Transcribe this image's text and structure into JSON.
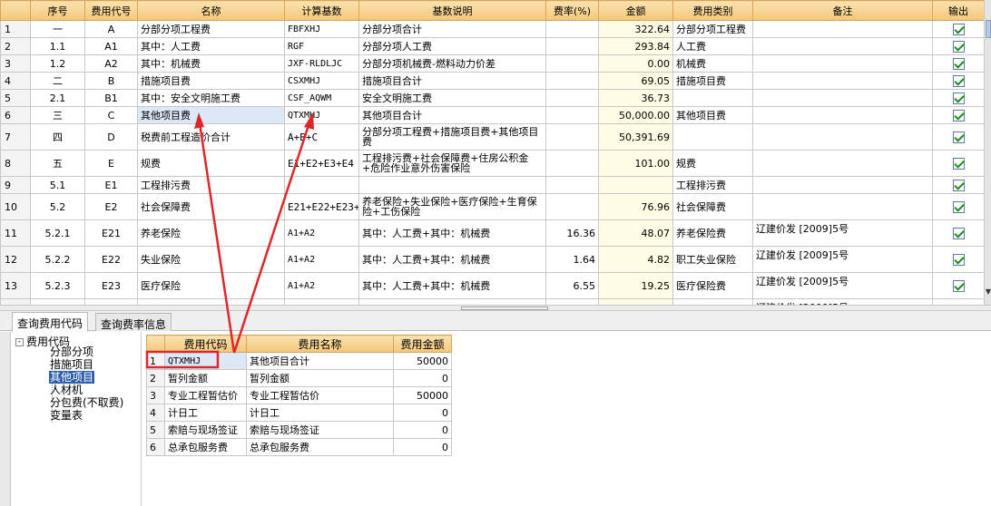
{
  "top_grid": {
    "headers": [
      "",
      "序号",
      "费用代号",
      "名称",
      "计算基数",
      "基数说明",
      "费率(%)",
      "金额",
      "费用类别",
      "备注",
      "输出"
    ],
    "rows": [
      {
        "num": "1",
        "seq": "一",
        "code": "A",
        "name": "分部分项工程费",
        "base": "FBFXHJ",
        "desc": "分部分项合计",
        "rate": "",
        "amount": "322.64",
        "category": "分部分项工程费",
        "remark": ""
      },
      {
        "num": "2",
        "seq": "1.1",
        "code": "A1",
        "name": "其中：人工费",
        "base": "RGF",
        "desc": "分部分项人工费",
        "rate": "",
        "amount": "293.84",
        "category": "人工费",
        "remark": ""
      },
      {
        "num": "3",
        "seq": "1.2",
        "code": "A2",
        "name": "其中：机械费",
        "base": "JXF-RLDLJC",
        "desc": "分部分项机械费-燃料动力价差",
        "rate": "",
        "amount": "0.00",
        "category": "机械费",
        "remark": ""
      },
      {
        "num": "4",
        "seq": "二",
        "code": "B",
        "name": "措施项目费",
        "base": "CSXMHJ",
        "desc": "措施项目合计",
        "rate": "",
        "amount": "69.05",
        "category": "措施项目费",
        "remark": ""
      },
      {
        "num": "5",
        "seq": "2.1",
        "code": "B1",
        "name": "其中：安全文明施工费",
        "base": "CSF_AQWM",
        "desc": "安全文明施工费",
        "rate": "",
        "amount": "36.73",
        "category": "",
        "remark": ""
      },
      {
        "num": "6",
        "seq": "三",
        "code": "C",
        "name": "其他项目费",
        "base": "QTXMHJ",
        "desc": "其他项目合计",
        "rate": "",
        "amount": "50,000.00",
        "category": "其他项目费",
        "remark": ""
      },
      {
        "num": "7",
        "seq": "四",
        "code": "D",
        "name": "税费前工程造价合计",
        "base": "A+B+C",
        "desc": "分部分项工程费+措施项目费+其他项目费",
        "rate": "",
        "amount": "50,391.69",
        "category": "",
        "remark": ""
      },
      {
        "num": "8",
        "seq": "五",
        "code": "E",
        "name": "规费",
        "base": "E1+E2+E3+E4",
        "desc": "工程排污费+社会保障费+住房公积金+危险作业意外伤害保险",
        "rate": "",
        "amount": "101.00",
        "category": "规费",
        "remark": ""
      },
      {
        "num": "9",
        "seq": "5.1",
        "code": "E1",
        "name": "工程排污费",
        "base": "",
        "desc": "",
        "rate": "",
        "amount": "",
        "category": "工程排污费",
        "remark": ""
      },
      {
        "num": "10",
        "seq": "5.2",
        "code": "E2",
        "name": "社会保障费",
        "base": "E21+E22+E23+E24+E25",
        "desc": "养老保险+失业保险+医疗保险+生育保险+工伤保险",
        "rate": "",
        "amount": "76.96",
        "category": "社会保障费",
        "remark": ""
      },
      {
        "num": "11",
        "seq": "5.2.1",
        "code": "E21",
        "name": "养老保险",
        "base": "A1+A2",
        "desc": "其中：人工费+其中：机械费",
        "rate": "16.36",
        "amount": "48.07",
        "category": "养老保险费",
        "remark": "辽建价发 [2009]5号"
      },
      {
        "num": "12",
        "seq": "5.2.2",
        "code": "E22",
        "name": "失业保险",
        "base": "A1+A2",
        "desc": "其中：人工费+其中：机械费",
        "rate": "1.64",
        "amount": "4.82",
        "category": "职工失业保险",
        "remark": "辽建价发 [2009]5号"
      },
      {
        "num": "13",
        "seq": "5.2.3",
        "code": "E23",
        "name": "医疗保险",
        "base": "A1+A2",
        "desc": "其中：人工费+其中：机械费",
        "rate": "6.55",
        "amount": "19.25",
        "category": "医疗保险费",
        "remark": "辽建价发 [2009]5号"
      }
    ],
    "partial_remark": "辽建价发 [2009]5号"
  },
  "tabs": {
    "code_query": "查询费用代码",
    "rate_query": "查询费率信息"
  },
  "tree": {
    "root": "费用代码",
    "root_toggle": "-",
    "items": [
      "分部分项",
      "措施项目",
      "其他项目",
      "人材机",
      "分包费(不取费)",
      "变量表"
    ],
    "selected_index": 2
  },
  "bottom_grid": {
    "headers": [
      "",
      "费用代码",
      "费用名称",
      "费用金额"
    ],
    "rows": [
      {
        "num": "1",
        "code": "QTXMHJ",
        "name": "其他项目合计",
        "amount": "50000"
      },
      {
        "num": "2",
        "code": "暂列金额",
        "name": "暂列金额",
        "amount": "0"
      },
      {
        "num": "3",
        "code": "专业工程暂估价",
        "name": "专业工程暂估价",
        "amount": "50000"
      },
      {
        "num": "4",
        "code": "计日工",
        "name": "计日工",
        "amount": "0"
      },
      {
        "num": "5",
        "code": "索赔与现场签证",
        "name": "索赔与现场签证",
        "amount": "0"
      },
      {
        "num": "6",
        "code": "总承包服务费",
        "name": "总承包服务费",
        "amount": "0"
      }
    ]
  },
  "annotation": {
    "color": "#e0262a"
  },
  "colors": {
    "header_bg": "#f3c77a",
    "selection": "#dde8f6",
    "amount_bg": "#fffce6",
    "tree_selected": "#2c5fb0"
  }
}
